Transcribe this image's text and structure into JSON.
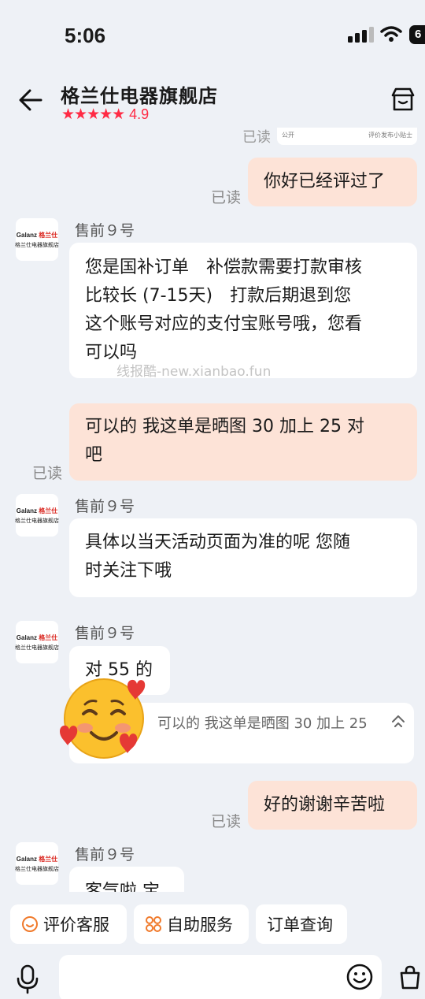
{
  "status_bar": {
    "time": "5:06",
    "battery": "6"
  },
  "header": {
    "store_name": "格兰仕电器旗舰店",
    "stars": "★★★★★",
    "rating": "4.9"
  },
  "peek": {
    "read": "已读",
    "public": "公开",
    "hint": "评价发布小贴士"
  },
  "messages": {
    "m1": {
      "text": "你好已经评过了",
      "read": "已读"
    },
    "m2": {
      "sender": "售前９号",
      "lines": [
        "您是国补订单　补偿款需要打款审核",
        "比较长 (7-15天)　打款后期退到您",
        "这个账号对应的支付宝账号哦，您看",
        "可以吗"
      ]
    },
    "m3": {
      "lines": [
        "可以的 我这单是晒图 30 加上 25 对",
        "吧"
      ],
      "read": "已读"
    },
    "m4": {
      "sender": "售前９号",
      "lines": [
        "具体以当天活动页面为准的呢 您随",
        "时关注下哦"
      ]
    },
    "m5": {
      "sender": "售前９号",
      "text": "对 55 的",
      "quote": "可以的 我这单是晒图 30 加上 25"
    },
    "m6": {
      "text": "好的谢谢辛苦啦",
      "read": "已读"
    },
    "m7": {
      "sender": "售前９号",
      "text": "客气啦 宝"
    }
  },
  "avatar": {
    "brand": "Galanz",
    "brand_cn": "格兰仕",
    "sub": "格兰仕电器旗舰店"
  },
  "watermark": "线报酷-new.xianbao.fun",
  "quick_actions": [
    {
      "label": "评价客服",
      "icon": "smile-circle-icon"
    },
    {
      "label": "自助服务",
      "icon": "grid-dots-icon"
    },
    {
      "label": "订单查询",
      "icon": ""
    }
  ],
  "colors": {
    "accent": "#ff2a44",
    "mine_bubble": "#fde3d7",
    "background": "#eef1f6",
    "icon_orange": "#f07a2b"
  }
}
